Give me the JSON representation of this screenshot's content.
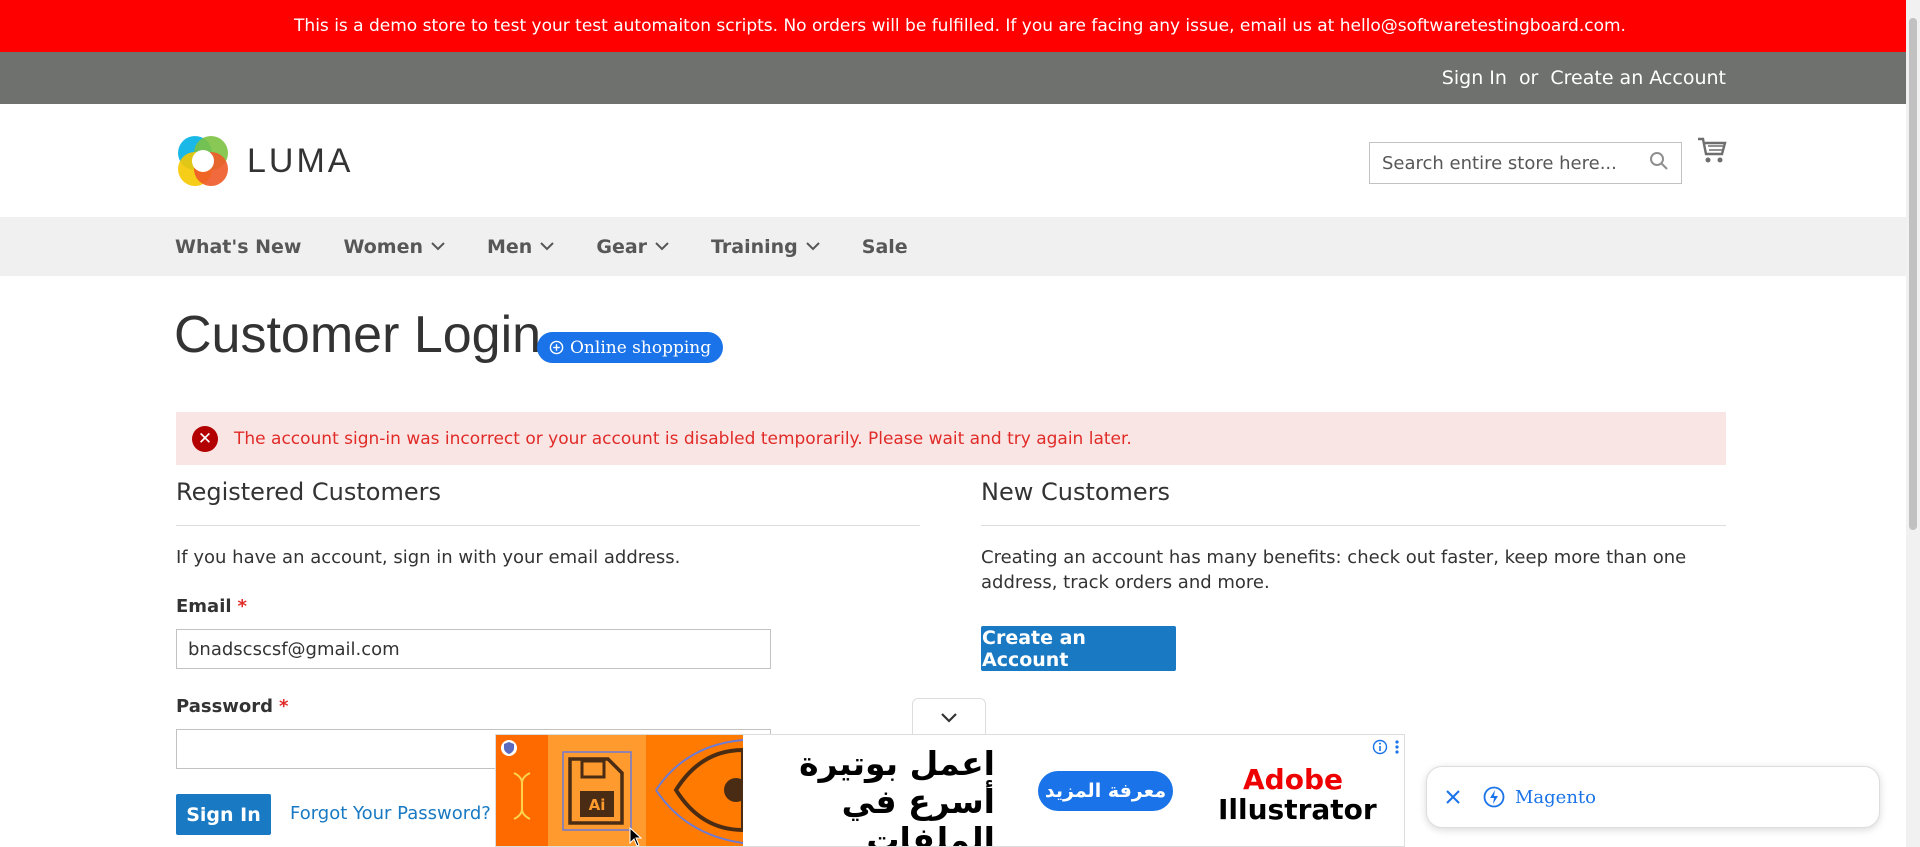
{
  "demo_notice": "This is a demo store to test your test automaiton scripts. No orders will be fulfilled. If you are facing any issue, email us at hello@softwaretestingboard.com.",
  "top_links": {
    "sign_in": "Sign In",
    "or": "or",
    "create_account": "Create an Account"
  },
  "logo": {
    "text": "LUMA",
    "icon": "luma-logo-icon"
  },
  "search": {
    "placeholder": "Search entire store here...",
    "icon": "search-icon"
  },
  "cart": {
    "icon": "cart-icon"
  },
  "nav": [
    {
      "label": "What's New",
      "has_menu": false
    },
    {
      "label": "Women",
      "has_menu": true
    },
    {
      "label": "Men",
      "has_menu": true
    },
    {
      "label": "Gear",
      "has_menu": true
    },
    {
      "label": "Training",
      "has_menu": true
    },
    {
      "label": "Sale",
      "has_menu": false
    }
  ],
  "page_title": "Customer Login",
  "pill": {
    "label": "Online shopping",
    "icon": "plus-circle-icon"
  },
  "error": {
    "message": "The account sign-in was incorrect or your account is disabled temporarily. Please wait and try again later.",
    "icon": "close-circle-icon"
  },
  "registered": {
    "title": "Registered Customers",
    "intro": "If you have an account, sign in with your email address.",
    "email_label": "Email",
    "email_value": "bnadscscsf@gmail.com",
    "password_label": "Password",
    "required_mark": "*",
    "sign_in_button": "Sign In",
    "forgot_link": "Forgot Your Password?"
  },
  "new_customers": {
    "title": "New Customers",
    "text": "Creating an account has many benefits: check out faster, keep more than one address, track orders and more.",
    "create_button": "Create an Account"
  },
  "ad": {
    "text": "اعمل بوتيرة أسرع في الملفات المعقدة.",
    "cta": "معرفة المزيد",
    "brand_line1": "Adobe",
    "brand_line2": "Illustrator",
    "file_badge": "Ai"
  },
  "magento_chip": {
    "label": "Magento"
  },
  "colors": {
    "accent": "#1979c3",
    "demo_bar": "#ff0000",
    "header_bar": "#6e716e",
    "error_bg": "#fae5e5",
    "error_text": "#e02b27"
  }
}
